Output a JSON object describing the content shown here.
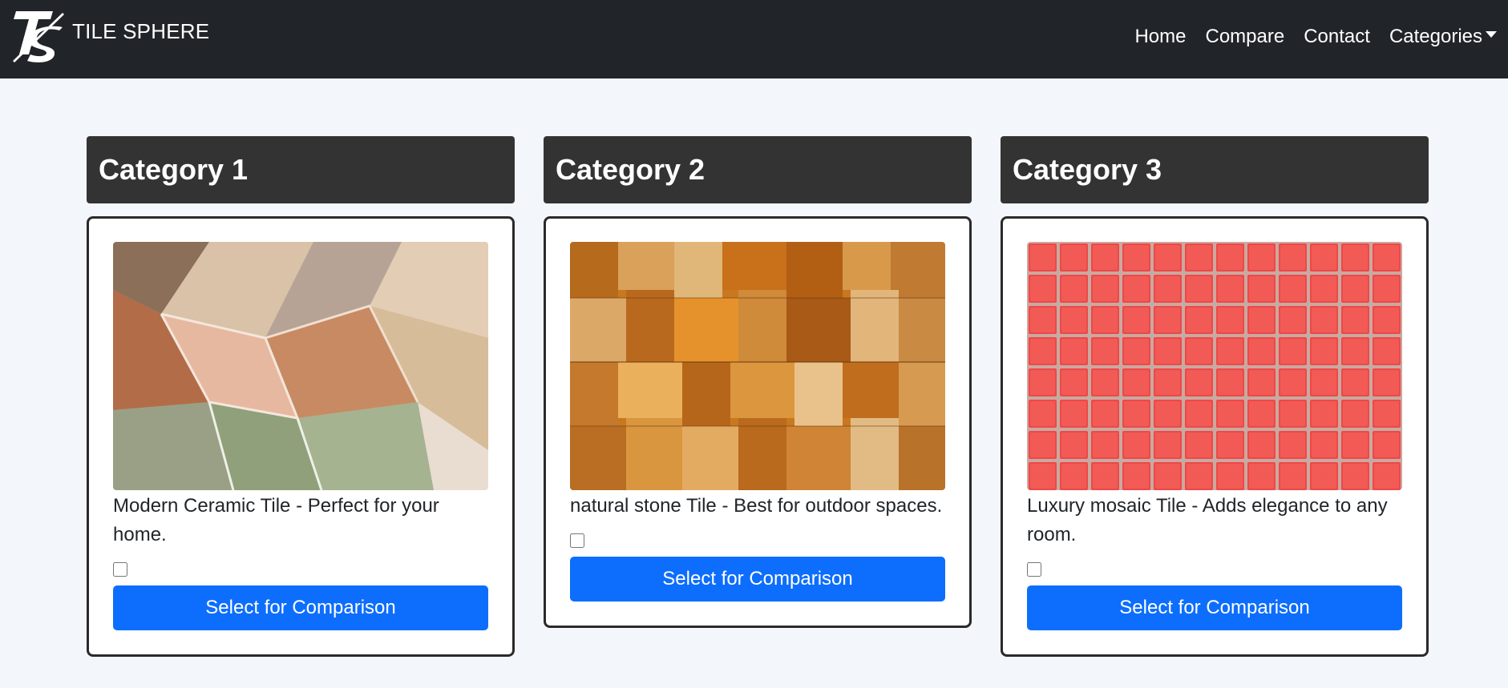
{
  "brand": {
    "name": "TILE SPHERE"
  },
  "nav": {
    "home": "Home",
    "compare": "Compare",
    "contact": "Contact",
    "categories": "Categories"
  },
  "categories": [
    {
      "title": "Category 1",
      "description": "Modern Ceramic Tile - Perfect for your home.",
      "button": "Select for Comparison"
    },
    {
      "title": "Category 2",
      "description": "natural stone Tile - Best for outdoor spaces.",
      "button": "Select for Comparison"
    },
    {
      "title": "Category 3",
      "description": "Luxury mosaic Tile - Adds elegance to any room.",
      "button": "Select for Comparison"
    }
  ],
  "colors": {
    "navbar": "#212529",
    "header": "#333333",
    "button": "#0d6efd",
    "background": "#f3f6fb"
  }
}
